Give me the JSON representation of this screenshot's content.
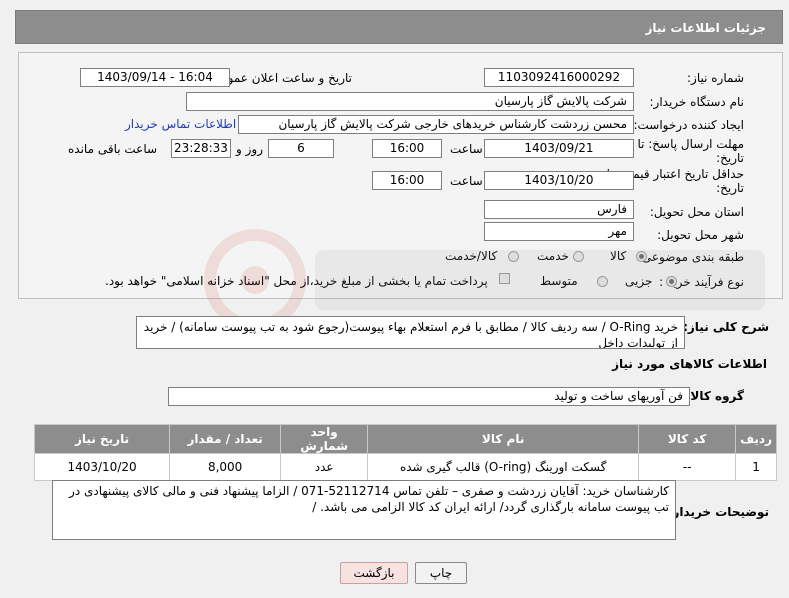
{
  "header": {
    "title": "جزئیات اطلاعات نیاز"
  },
  "form": {
    "need_number": {
      "label": "شماره نیاز:",
      "value": "1103092416000292"
    },
    "announce_datetime": {
      "label": "تاریخ و ساعت اعلان عمومی:",
      "value": "1403/09/14 - 16:04"
    },
    "buyer_org": {
      "label": "نام دستگاه خریدار:",
      "value": "شرکت پالایش گاز پارسیان"
    },
    "requester": {
      "label": "ایجاد کننده درخواست:",
      "value": "محسن زردشت کارشناس خریدهای خارجی شرکت پالایش گاز پارسیان",
      "contact_link": "اطلاعات تماس خریدار"
    },
    "reply_deadline": {
      "label_line1": "مهلت ارسال پاسخ: تا",
      "label_line2": "تاریخ:",
      "date": "1403/09/21",
      "time_label": "ساعت",
      "time": "16:00",
      "days": "6",
      "days_label": "روز و",
      "remaining": "23:28:33",
      "remaining_label": "ساعت باقی مانده"
    },
    "price_validity": {
      "label_line1": "حداقل تاریخ اعتبار قیمت: تا",
      "label_line2": "تاریخ:",
      "date": "1403/10/20",
      "time_label": "ساعت",
      "time": "16:00"
    },
    "delivery_province": {
      "label": "استان محل تحویل:",
      "value": "فارس"
    },
    "delivery_city": {
      "label": "شهر محل تحویل:",
      "value": "مهر"
    },
    "category": {
      "label": "طبقه بندی موضوعی:",
      "options": [
        "کالا",
        "خدمت",
        "کالا/خدمت"
      ]
    },
    "purchase_type": {
      "label": "نوع فرآیند خرید :",
      "options": [
        "جزیی",
        "متوسط"
      ],
      "payment_note": "پرداخت تمام یا بخشی از مبلغ خرید،از محل \"اسناد خزانه اسلامی\" خواهد بود."
    }
  },
  "description": {
    "label": "شرح کلی نیاز:",
    "text": "خرید O-Ring / سه ردیف کالا / مطابق با فرم استعلام بهاء پیوست(رجوع شود به تب پیوست سامانه) / خرید از تولیدات داخل"
  },
  "goods_section": {
    "title": "اطلاعات کالاهای مورد نیاز",
    "group_label": "گروه کالا:",
    "group_value": "فن آوریهای ساخت و تولید"
  },
  "table": {
    "headers": [
      "ردیف",
      "کد کالا",
      "نام کالا",
      "واحد شمارش",
      "تعداد / مقدار",
      "تاریخ نیاز"
    ],
    "rows": [
      [
        "1",
        "--",
        "گسکت اورینگ (O-ring) قالب گیری شده",
        "عدد",
        "8,000",
        "1403/10/20"
      ]
    ]
  },
  "buyer_notes": {
    "label": "توضیحات خریدار:",
    "text": "کارشناسان خرید: آقایان زردشت و صفری – تلفن تماس 52112714-071 / الزاما پیشنهاد فنی و مالی کالای پیشنهادی در تب پیوست سامانه بارگذاری گردد/ ارائه ایران کد کالا الزامی می باشد. /"
  },
  "buttons": {
    "print": "چاپ",
    "back": "بازگشت"
  },
  "colors": {
    "header_bg": "#8d8d8d",
    "link": "#1f3fae",
    "back_button_bg": "#f8e1e1"
  }
}
